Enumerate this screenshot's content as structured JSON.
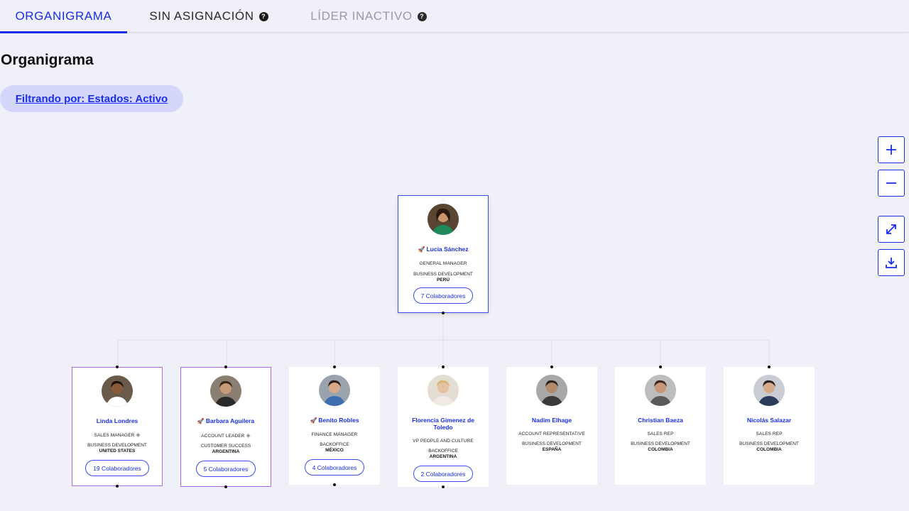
{
  "tabs": [
    {
      "label": "ORGANIGRAMA",
      "active": true,
      "help": false
    },
    {
      "label": "SIN ASIGNACIÓN",
      "active": false,
      "help": true
    },
    {
      "label": "LÍDER INACTIVO",
      "active": false,
      "help": true
    }
  ],
  "help_glyph": "?",
  "page_title": "Organigrama",
  "filter_chip": "Filtrando por: Estados: Activo",
  "controls": {
    "zoom_in": "zoom-in-icon",
    "zoom_out": "zoom-out-icon",
    "fit": "expand-icon",
    "download": "download-icon"
  },
  "colors": {
    "accent": "#1a2fe6",
    "chip_bg": "#d4d7fb",
    "highlight_border": "#b069e8",
    "page_bg": "#f0f0f8"
  },
  "root": {
    "name": "Lucía Sánchez",
    "rocket": true,
    "role": "GENERAL MANAGER",
    "department": "BUSINESS DEVELOPMENT",
    "country": "PERÚ",
    "collaborators": "7 Colaboradores"
  },
  "children": [
    {
      "name": "Linda Londres",
      "rocket": false,
      "role": "SALES MANAGER",
      "gem": true,
      "department": "BUSINESS DEVELOPMENT",
      "country": "UNITED STATES",
      "collaborators": "19 Colaboradores",
      "highlight": true
    },
    {
      "name": "Barbara Aguilera",
      "rocket": true,
      "role": "ACCOUNT LEADER",
      "gem": true,
      "department": "CUSTOMER SUCCESS",
      "country": "ARGENTINA",
      "collaborators": "5 Colaboradores",
      "highlight": true
    },
    {
      "name": "Benito Robles",
      "rocket": true,
      "role": "FINANCE MANAGER",
      "gem": false,
      "department": "BACKOFFICE",
      "country": "MÉXICO",
      "collaborators": "4 Colaboradores",
      "highlight": false
    },
    {
      "name": "Florencia Gimenez de Toledo",
      "rocket": false,
      "role": "VP PEOPLE AND CULTURE",
      "gem": false,
      "department": "BACKOFFICE",
      "country": "ARGENTINA",
      "collaborators": "2 Colaboradores",
      "highlight": false
    },
    {
      "name": "Nadim Elhage",
      "rocket": false,
      "role": "ACCOUNT REPRESENTATIVE",
      "gem": false,
      "department": "BUSINESS DEVELOPMENT",
      "country": "ESPAÑA",
      "collaborators": "",
      "highlight": false
    },
    {
      "name": "Christian Baeza",
      "rocket": false,
      "role": "SALES REP",
      "gem": false,
      "department": "BUSINESS DEVELOPMENT",
      "country": "COLOMBIA",
      "collaborators": "",
      "highlight": false
    },
    {
      "name": "Nicolás Salazar",
      "rocket": false,
      "role": "SALES REP",
      "gem": false,
      "department": "BUSINESS DEVELOPMENT",
      "country": "COLOMBIA",
      "collaborators": "",
      "highlight": false
    }
  ]
}
